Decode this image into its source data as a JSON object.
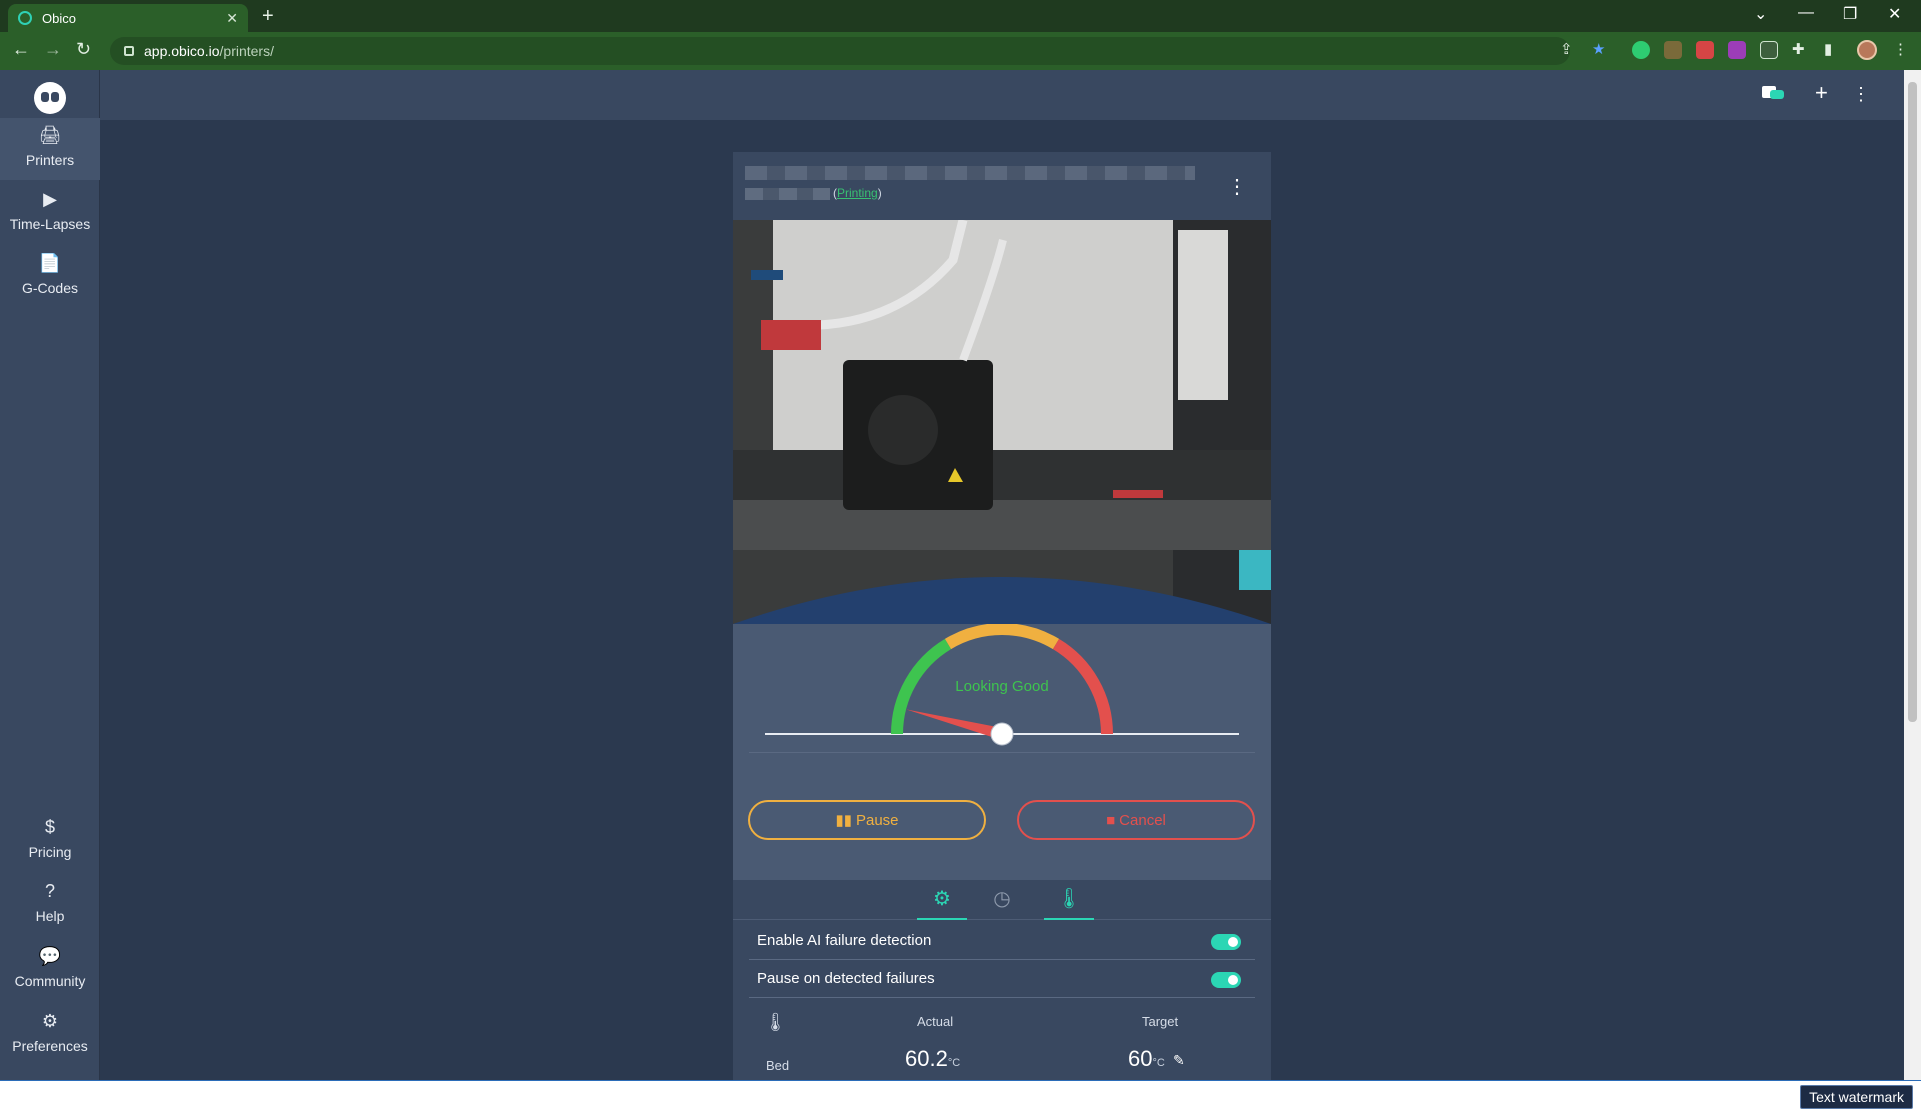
{
  "browser": {
    "tab_title": "Obico",
    "tab_close": "✕",
    "new_tab": "+",
    "url_host": "app.obico.io",
    "url_path": "/printers/",
    "window_controls": [
      "⌄",
      "—",
      "❐",
      "✕"
    ]
  },
  "sidebar": {
    "items_top": [
      {
        "label": "Printers",
        "icon": "printer-icon",
        "glyph": "🖨"
      },
      {
        "label": "Time-Lapses",
        "icon": "video-icon",
        "glyph": "▶"
      },
      {
        "label": "G-Codes",
        "icon": "file-code-icon",
        "glyph": "📄"
      }
    ],
    "items_bottom": [
      {
        "label": "Pricing",
        "icon": "dollar-icon",
        "glyph": "$"
      },
      {
        "label": "Help",
        "icon": "question-icon",
        "glyph": "?"
      },
      {
        "label": "Community",
        "icon": "comments-icon",
        "glyph": "💬"
      },
      {
        "label": "Preferences",
        "icon": "gear-icon",
        "glyph": "⚙"
      }
    ]
  },
  "topbar": {
    "add": "+",
    "menu": "⋮"
  },
  "printer_card": {
    "status_prefix": "(",
    "status": "Printing",
    "status_suffix": ")",
    "menu": "⋮",
    "gauge_label": "Looking Good",
    "gauge_level": 0.08,
    "pause_label": "Pause",
    "cancel_label": "Cancel",
    "settings": [
      {
        "label": "Enable AI failure detection",
        "on": true
      },
      {
        "label": "Pause on detected failures",
        "on": true
      }
    ],
    "temps": {
      "actual_header": "Actual",
      "target_header": "Target",
      "row_label": "Bed",
      "actual_value": "60.2",
      "target_value": "60",
      "unit": "°C"
    }
  },
  "watermark": "Text watermark",
  "colors": {
    "accent": "#2bd6b4",
    "pause": "#f0b040",
    "cancel": "#e3504d",
    "good": "#3ec44f"
  }
}
